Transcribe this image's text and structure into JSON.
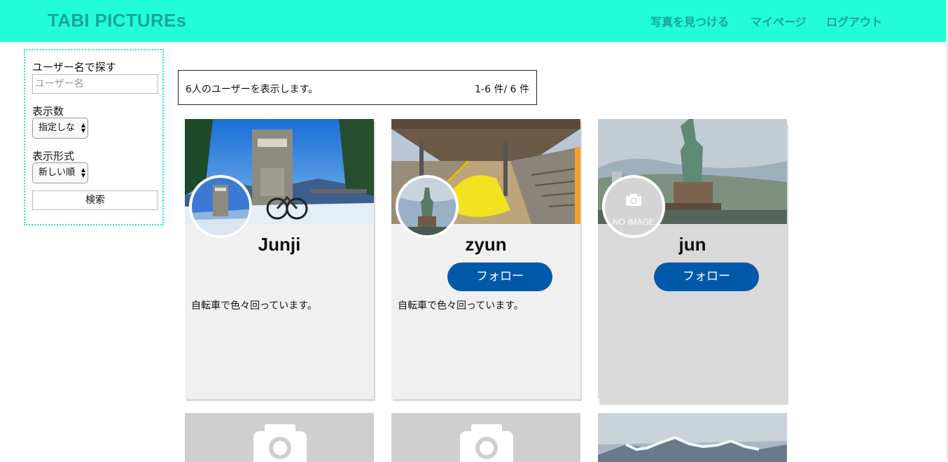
{
  "header": {
    "brand": "TABI PICTUREs",
    "nav": [
      "写真を見つける",
      "マイページ",
      "ログアウト"
    ]
  },
  "sidebar": {
    "search_label": "ユーザー名で探す",
    "search_placeholder": "ユーザー名",
    "count_label": "表示数",
    "count_value": "指定しな",
    "format_label": "表示形式",
    "format_value": "新しい順",
    "search_button": "検索"
  },
  "info": {
    "summary": "6人のユーザーを表示します。",
    "range": "1-6 件/ 6 件"
  },
  "users": [
    {
      "name": "Junji",
      "bio": "自転車で色々回っています。",
      "follow": ""
    },
    {
      "name": "zyun",
      "bio": "自転車で色々回っています。",
      "follow": "フォロー"
    },
    {
      "name": "jun",
      "bio": "",
      "follow": "フォロー",
      "no_image": "NO IMAGE"
    }
  ],
  "colors": {
    "header": "#22fdd8",
    "brand": "#16a59a",
    "follow": "#0059a8"
  }
}
